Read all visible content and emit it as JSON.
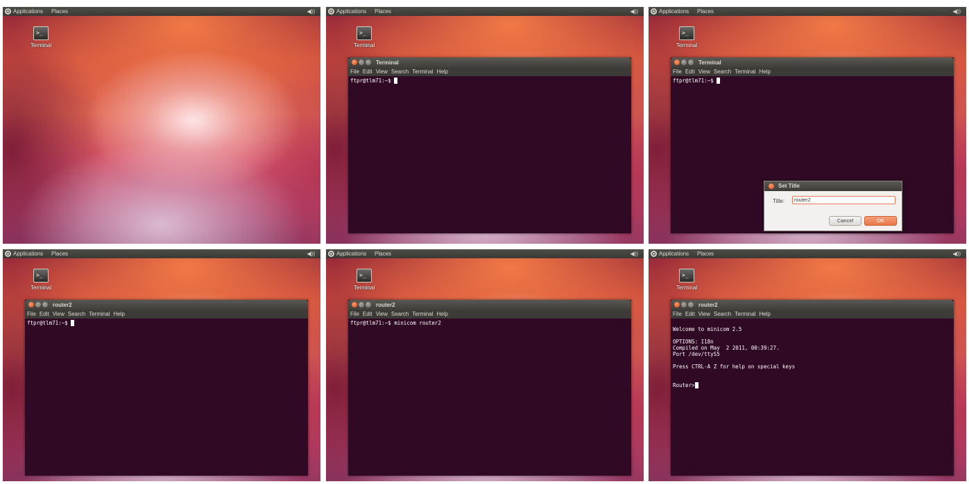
{
  "panels": [
    {
      "topbar": {
        "applications": "Applications",
        "places": "Places",
        "volume_icon": "speaker-icon"
      },
      "desktop_icon": {
        "label": "Terminal"
      },
      "has_terminal": false
    },
    {
      "topbar": {
        "applications": "Applications",
        "places": "Places",
        "volume_icon": "speaker-icon"
      },
      "desktop_icon": {
        "label": "Terminal"
      },
      "has_terminal": true,
      "terminal": {
        "title": "Terminal",
        "menu": [
          "File",
          "Edit",
          "View",
          "Search",
          "Terminal",
          "Help"
        ],
        "lines": [
          "ftpr@tlm71:~$ "
        ],
        "cursor_line": 0
      }
    },
    {
      "topbar": {
        "applications": "Applications",
        "places": "Places",
        "volume_icon": "speaker-icon"
      },
      "desktop_icon": {
        "label": "Terminal"
      },
      "has_terminal": true,
      "terminal": {
        "title": "Terminal",
        "menu": [
          "File",
          "Edit",
          "View",
          "Search",
          "Terminal",
          "Help"
        ],
        "lines": [
          "ftpr@tlm71:~$ "
        ],
        "cursor_line": 0
      },
      "dialog": {
        "title": "Set Title",
        "field_label": "Title:",
        "field_value": "router2",
        "cancel_label": "Cancel",
        "ok_label": "OK"
      }
    },
    {
      "topbar": {
        "applications": "Applications",
        "places": "Places",
        "volume_icon": "speaker-icon"
      },
      "desktop_icon": {
        "label": "Terminal"
      },
      "has_terminal": true,
      "terminal": {
        "title": "router2",
        "menu": [
          "File",
          "Edit",
          "View",
          "Search",
          "Terminal",
          "Help"
        ],
        "lines": [
          "ftpr@tlm71:~$ "
        ],
        "cursor_line": 0
      }
    },
    {
      "topbar": {
        "applications": "Applications",
        "places": "Places",
        "volume_icon": "speaker-icon"
      },
      "desktop_icon": {
        "label": "Terminal"
      },
      "has_terminal": true,
      "terminal": {
        "title": "router2",
        "menu": [
          "File",
          "Edit",
          "View",
          "Search",
          "Terminal",
          "Help"
        ],
        "lines": [
          "ftpr@tlm71:~$ minicom router2"
        ],
        "cursor_line": -1
      }
    },
    {
      "topbar": {
        "applications": "Applications",
        "places": "Places",
        "volume_icon": "speaker-icon"
      },
      "desktop_icon": {
        "label": "Terminal"
      },
      "has_terminal": true,
      "terminal": {
        "title": "router2",
        "menu": [
          "File",
          "Edit",
          "View",
          "Search",
          "Terminal",
          "Help"
        ],
        "lines": [
          "",
          "Welcome to minicom 2.5",
          "",
          "OPTIONS: I18n",
          "Compiled on May  2 2011, 00:39:27.",
          "Port /dev/ttyS5",
          "",
          "Press CTRL-A Z for help on special keys",
          "",
          "",
          "Router>"
        ],
        "cursor_line": 10
      }
    }
  ]
}
